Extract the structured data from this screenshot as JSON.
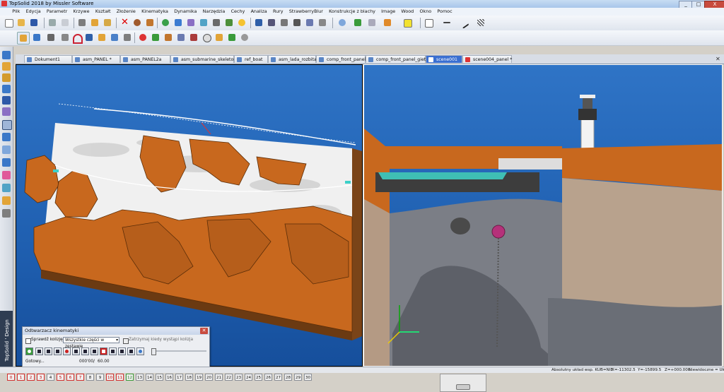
{
  "window": {
    "title": "TopSolid 2018 by Missler Software",
    "controls": [
      "_",
      "□",
      "X"
    ]
  },
  "menu": [
    "Plik",
    "Edycja",
    "Parametr",
    "Krzywe",
    "Kształt",
    "Złożenie",
    "Kinematyka",
    "Dynamika",
    "Narzędzia",
    "Cechy",
    "Analiza",
    "Rury",
    "StrawberryBlur",
    "Konstrukcje z blachy",
    "Image",
    "Wood",
    "Okno",
    "Pomoc"
  ],
  "tabs": [
    {
      "label": "Dokument1"
    },
    {
      "label": "asm_PANEL *"
    },
    {
      "label": "asm_PANEL2a"
    },
    {
      "label": "asm_submarine_skeleton"
    },
    {
      "label": "ref_boat"
    },
    {
      "label": "asm_lada_rozbita"
    },
    {
      "label": "comp_front_panel"
    },
    {
      "label": "comp_front_panel_giety"
    },
    {
      "label": "scene001",
      "active": true
    },
    {
      "label": "scene004_panel *"
    }
  ],
  "brand": "TopSolid ' Design",
  "kinematics_dialog": {
    "title": "Odtwarzacz kinematyki",
    "check_collision_label": "Sprawdź kolizję",
    "scope_select": "Wszystkie części w zestawie",
    "stop_on_collision_label": "Zatrzymaj kiedy wystąpi kolizja",
    "status_label": "Gotowy...",
    "time_current": "000'00",
    "time_separator": "/",
    "time_total": "60.00",
    "progress": 0
  },
  "status": {
    "prefix": "Absolutny układ wsp. KUB=NIE",
    "x": "X=-11302.5",
    "y": "Y=-15899.5",
    "z": "Z=+000.000",
    "visibility": "Niewidoczne = Ukr"
  },
  "layers": [
    "0",
    "1",
    "2",
    "3",
    "4",
    "5",
    "6",
    "7",
    "8",
    "9",
    "10",
    "11",
    "12",
    "13",
    "14",
    "15",
    "16",
    "17",
    "18",
    "19",
    "20",
    "21",
    "22",
    "23",
    "24",
    "25",
    "26",
    "27",
    "28",
    "29",
    "30"
  ],
  "colors": {
    "viewport_bg": "#2a6bbf",
    "land": "#c8681e",
    "terrain": "#f2f2f2",
    "active_tab": "#3a6fd1",
    "close": "#c84b3e"
  }
}
